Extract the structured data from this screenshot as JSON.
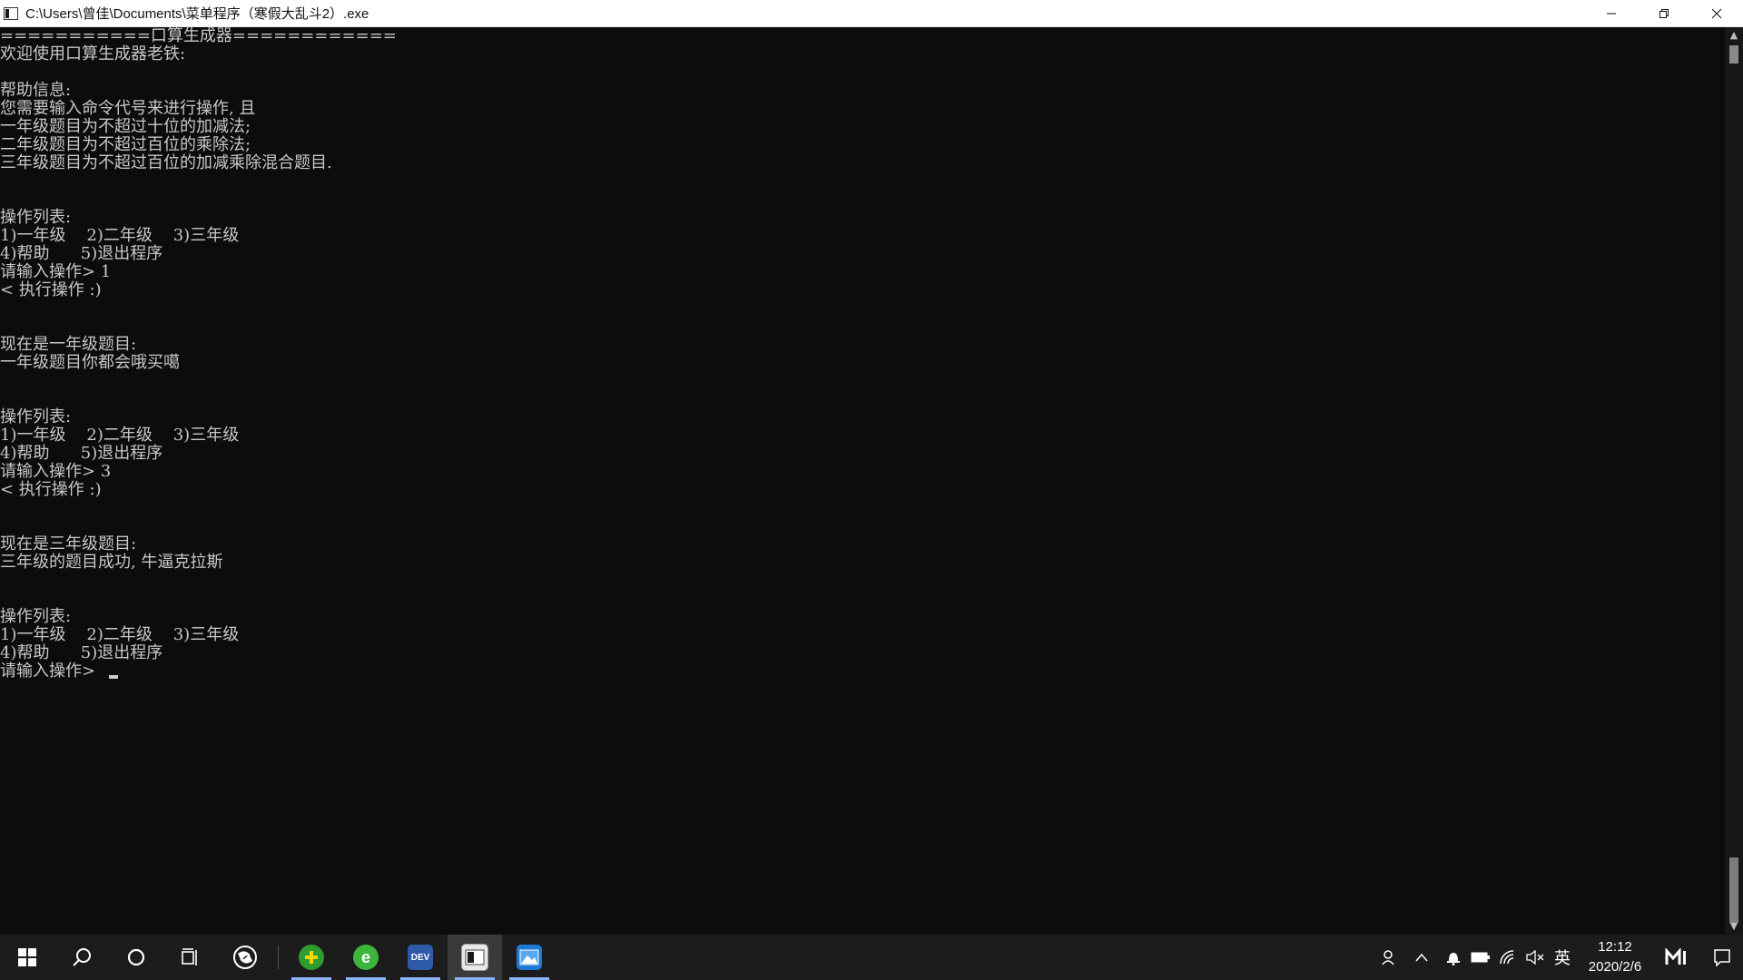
{
  "window": {
    "title": "C:\\Users\\曾佳\\Documents\\菜单程序（寒假大乱斗2）.exe"
  },
  "console": {
    "lines": [
      "===========口算生成器============",
      "欢迎使用口算生成器老铁:",
      "",
      "帮助信息:",
      "您需要输入命令代号来进行操作, 且",
      "一年级题目为不超过十位的加减法;",
      "二年级题目为不超过百位的乘除法;",
      "三年级题目为不超过百位的加减乘除混合题目.",
      "",
      "",
      "操作列表:",
      "1)一年级    2)二年级    3)三年级",
      "4)帮助      5)退出程序",
      "请输入操作> 1",
      "< 执行操作 :)",
      "",
      "",
      "现在是一年级题目:",
      "一年级题目你都会哦买噶",
      "",
      "",
      "操作列表:",
      "1)一年级    2)二年级    3)三年级",
      "4)帮助      5)退出程序",
      "请输入操作> 3",
      "< 执行操作 :)",
      "",
      "",
      "现在是三年级题目:",
      "三年级的题目成功, 牛逼克拉斯",
      "",
      "",
      "操作列表:",
      "1)一年级    2)二年级    3)三年级",
      "4)帮助      5)退出程序",
      "请输入操作>"
    ]
  },
  "taskbar": {
    "apps": [
      {
        "name": "start-button",
        "icon": "windows-logo-icon"
      },
      {
        "name": "search-button",
        "icon": "search-icon"
      },
      {
        "name": "cortana-button",
        "icon": "circle-icon"
      },
      {
        "name": "task-view-button",
        "icon": "task-view-icon"
      },
      {
        "name": "app-swirl",
        "icon": "swirl-app-icon"
      },
      {
        "name": "app-360-plus",
        "icon": "green-plus-icon"
      },
      {
        "name": "app-360-browser",
        "icon": "green-e-icon"
      },
      {
        "name": "app-devcpp",
        "icon": "devcpp-icon",
        "label": "DEV"
      },
      {
        "name": "app-console",
        "icon": "console-icon"
      },
      {
        "name": "app-photos",
        "icon": "photos-icon"
      }
    ],
    "tray": {
      "ime": "英",
      "time": "12:12",
      "date": "2020/2/6"
    }
  }
}
